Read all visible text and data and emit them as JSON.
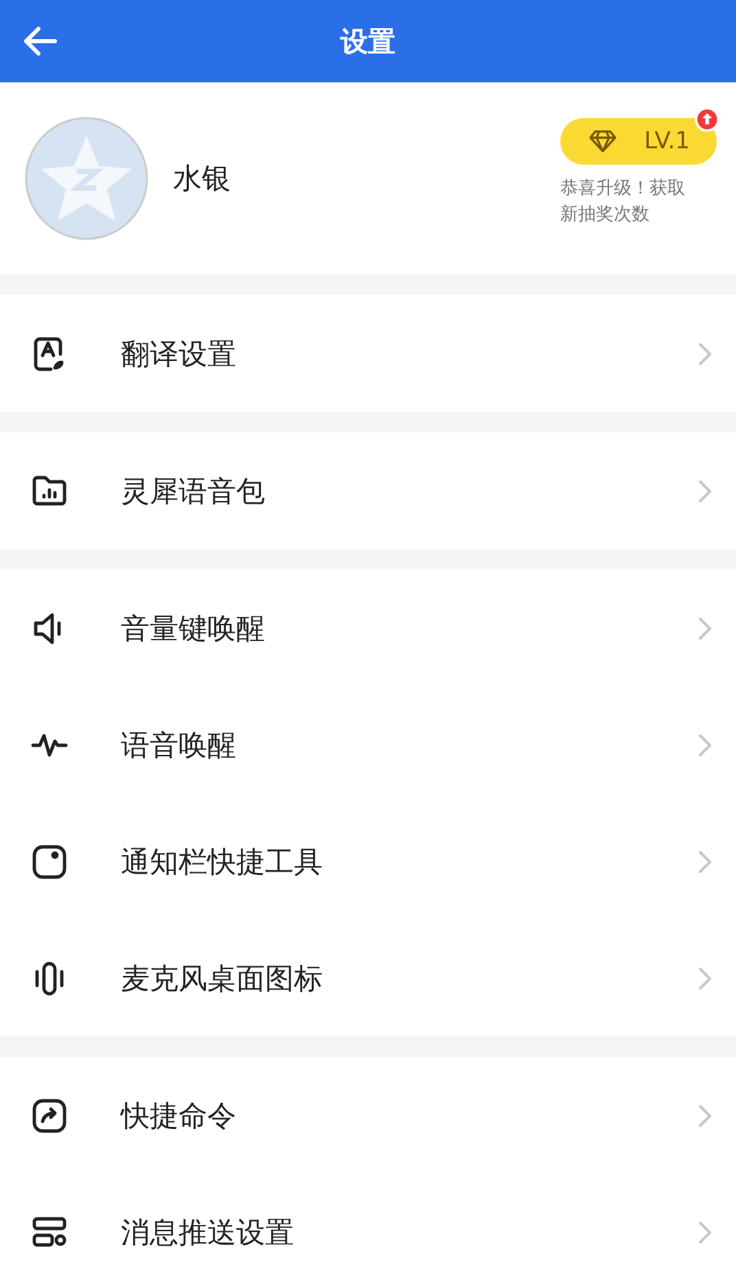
{
  "header": {
    "title": "设置"
  },
  "profile": {
    "name": "水银",
    "level": "LV.1",
    "upgrade_badge": true,
    "note": "恭喜升级！获取新抽奖次数"
  },
  "groups": [
    {
      "items": [
        {
          "kind": "translate",
          "label": "翻译设置"
        }
      ]
    },
    {
      "items": [
        {
          "kind": "folder",
          "label": "灵犀语音包"
        }
      ]
    },
    {
      "items": [
        {
          "kind": "speaker",
          "label": "音量键唤醒"
        },
        {
          "kind": "wave",
          "label": "语音唤醒"
        },
        {
          "kind": "notify",
          "label": "通知栏快捷工具"
        },
        {
          "kind": "mic",
          "label": "麦克风桌面图标"
        }
      ]
    },
    {
      "items": [
        {
          "kind": "shortcut",
          "label": "快捷命令"
        },
        {
          "kind": "push",
          "label": "消息推送设置"
        }
      ]
    }
  ]
}
